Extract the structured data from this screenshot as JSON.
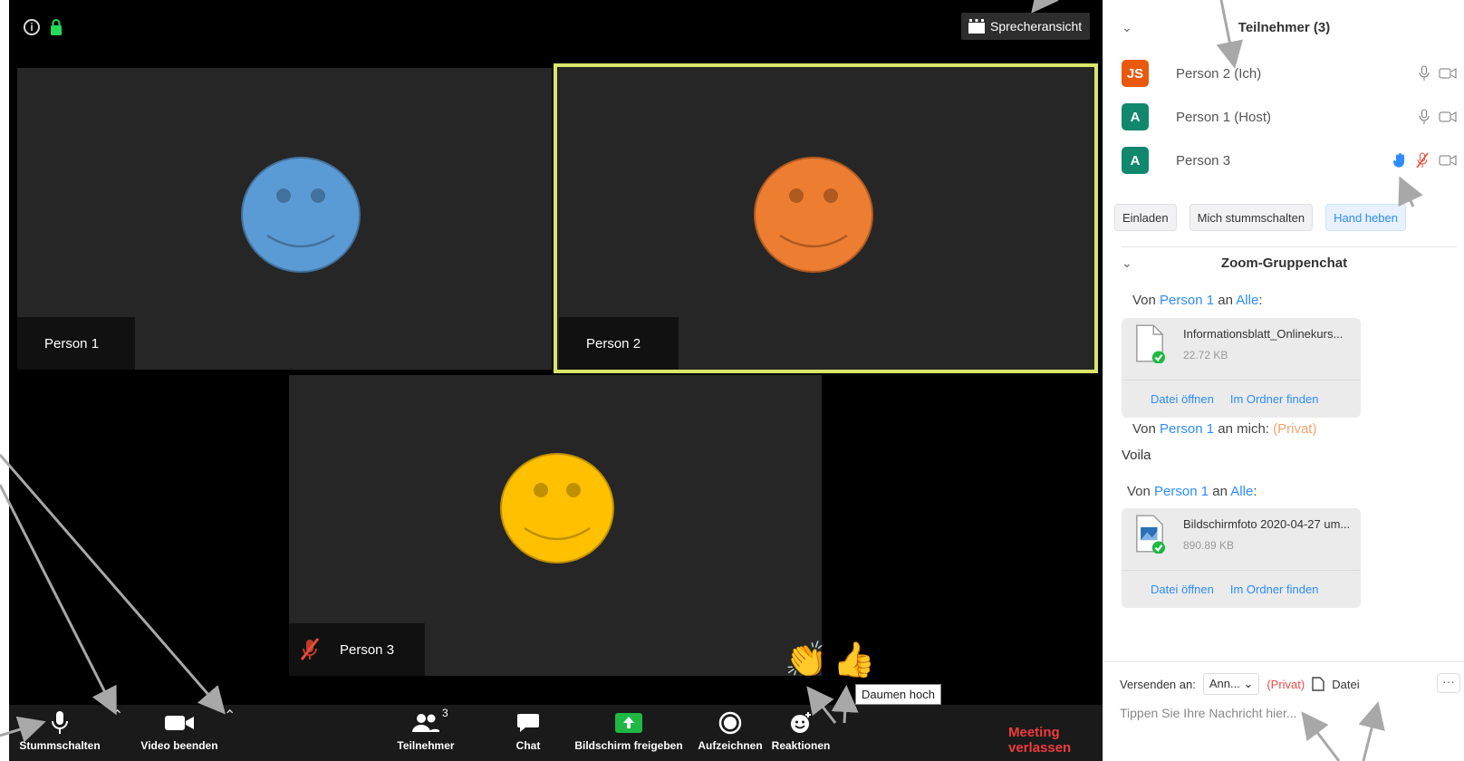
{
  "meeting": {
    "view_button_label": "Sprecheransicht",
    "tiles": [
      {
        "name": "Person 1",
        "face_color": "#5b9bd5"
      },
      {
        "name": "Person 2",
        "face_color": "#ed7d31"
      },
      {
        "name": "Person 3",
        "face_color": "#ffc000"
      }
    ],
    "reactions": [
      "👏",
      "👍"
    ],
    "tooltip": "Daumen hoch",
    "highlight_color": "#d9e66a"
  },
  "toolbar": {
    "mute_label": "Stummschalten",
    "video_label": "Video beenden",
    "participants_label": "Teilnehmer",
    "participants_count": "3",
    "chat_label": "Chat",
    "share_label": "Bildschirm freigeben",
    "record_label": "Aufzeichnen",
    "reactions_label": "Reaktionen",
    "leave_label": "Meeting verlassen"
  },
  "panel": {
    "participants_title": "Teilnehmer (3)",
    "participants": [
      {
        "initials": "JS",
        "name": "Person 2 (Ich)",
        "color": "#e8590c"
      },
      {
        "initials": "A",
        "name": "Person 1 (Host)",
        "color": "#11876e"
      },
      {
        "initials": "A",
        "name": "Person 3",
        "color": "#11876e"
      }
    ],
    "actions": {
      "invite": "Einladen",
      "mute_me": "Mich stummschalten",
      "raise_hand": "Hand heben"
    },
    "chat_title": "Zoom-Gruppenchat",
    "messages": [
      {
        "from_prefix": "Von",
        "sender": "Person 1",
        "mid": "an",
        "target": "Alle",
        "suffix": ":",
        "private": ""
      },
      {
        "from_prefix": "Von",
        "sender": "Person 1",
        "mid": "an mich:",
        "target": "",
        "suffix": "",
        "private": "(Privat)"
      },
      {
        "from_prefix": "Von",
        "sender": "Person 1",
        "mid": "an",
        "target": "Alle",
        "suffix": ":",
        "private": ""
      }
    ],
    "plain_message": "Voila",
    "files": [
      {
        "name": "Informationsblatt_Onlinekurs...",
        "size": "22.72 KB",
        "open": "Datei öffnen",
        "find": "Im Ordner finden"
      },
      {
        "name": "Bildschirmfoto 2020-04-27 um...",
        "size": "890.89 KB",
        "open": "Datei öffnen",
        "find": "Im Ordner finden"
      }
    ],
    "send": {
      "label": "Versenden an:",
      "recipient": "Ann...",
      "private": "(Privat)",
      "file_label": "Datei",
      "more": "···",
      "placeholder": "Tippen Sie Ihre Nachricht hier..."
    }
  }
}
